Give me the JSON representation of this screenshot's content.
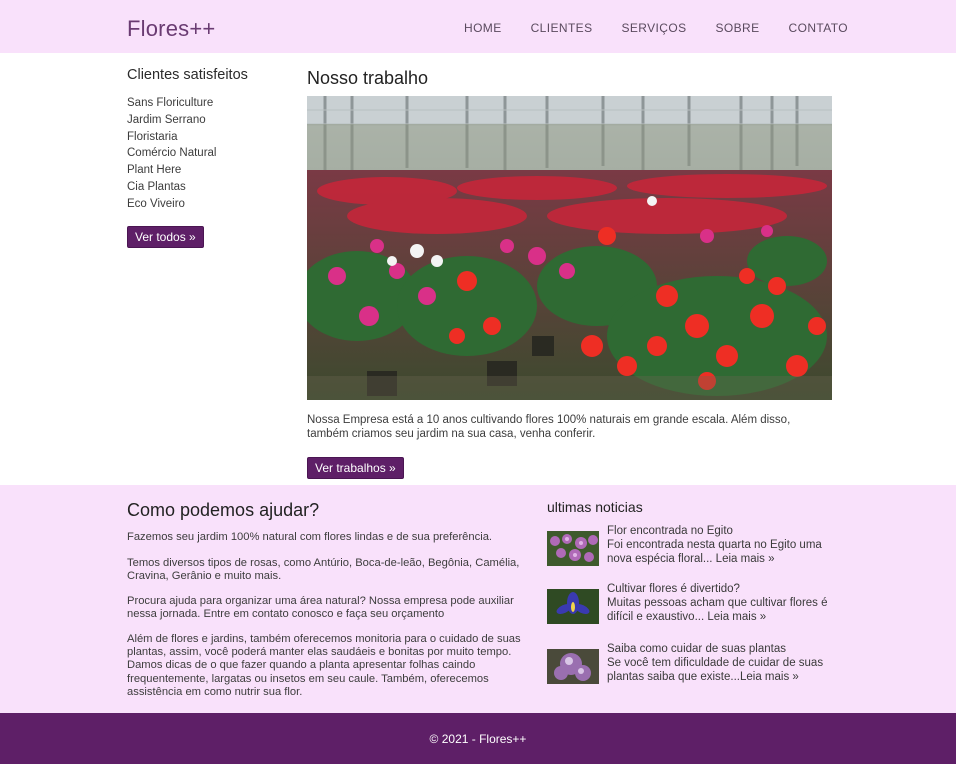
{
  "header": {
    "logo": "Flores++",
    "nav": [
      "HOME",
      "CLIENTES",
      "SERVIÇOS",
      "SOBRE",
      "CONTATO"
    ]
  },
  "clients": {
    "title": "Clientes satisfeitos",
    "items": [
      "Sans Floriculture",
      "Jardim Serrano",
      "Floristaria",
      "Comércio Natural",
      "Plant Here",
      "Cia Plantas",
      "Eco Viveiro"
    ],
    "button": "Ver todos »"
  },
  "work": {
    "title": "Nosso trabalho",
    "text": "Nossa Empresa está a 10 anos cultivando flores 100% naturais em grande escala. Além disso, também criamos seu jardim na sua casa, venha conferir.",
    "button": "Ver trabalhos »"
  },
  "help": {
    "title": "Como podemos ajudar?",
    "paragraphs": [
      "Fazemos seu jardim 100% natural com flores lindas e de sua preferência.",
      "Temos diversos tipos de rosas, como Antúrio, Boca-de-leão, Begônia, Camélia, Cravina, Gerânio e muito mais.",
      "Procura ajuda para organizar uma área natural? Nossa empresa pode auxiliar nessa jornada. Entre em contato conosco e faça seu orçamento",
      "Além de flores e jardins, também oferecemos monitoria para o cuidado de suas plantas, assim, você poderá manter elas saudáeis e bonitas por muito tempo. Damos dicas de o que fazer quando a planta apresentar folhas caindo frequentemente, largatas ou insetos em seu caule. Também, oferecemos assistência em como nutrir sua flor."
    ]
  },
  "news": {
    "title": "ultimas noticias",
    "items": [
      {
        "headline": "Flor encontrada no Egito",
        "body": "Foi encontrada nesta quarta no Egito uma nova espécia floral... Leia mais »"
      },
      {
        "headline": "Cultivar flores é divertido?",
        "body": "Muitas pessoas acham que cultivar flores é difícil e exaustivo... Leia mais »"
      },
      {
        "headline": "Saiba como cuidar de suas plantas",
        "body": "Se você tem dificuldade de cuidar de suas plantas saiba que existe...Leia mais »"
      }
    ]
  },
  "footer": {
    "text": "© 2021 - Flores++"
  },
  "colors": {
    "header_bg": "#f9e1fb",
    "accent": "#5e1f67",
    "logo": "#6a3b72"
  }
}
